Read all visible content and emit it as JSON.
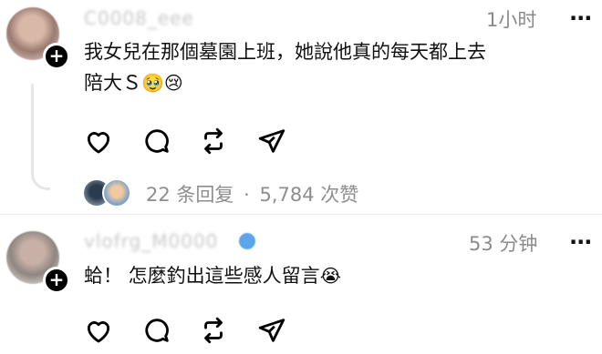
{
  "comments": [
    {
      "username": "C0008_eee",
      "time": "1小时",
      "text_line1": "我女兒在那個墓園上班，她說他真的每天都上去",
      "text_line2": "陪大Ｓ",
      "emoji": "🥹😢",
      "replies_count": "22 条回复",
      "separator": "·",
      "likes": "5,784 次赞"
    },
    {
      "username": "vlofrg_M0000",
      "time": "53 分钟",
      "text_line1": "蛤！ 怎麼釣出這些感人留言",
      "emoji": "😭"
    }
  ],
  "more_icon": "···",
  "plus_icon": "+",
  "colors": {
    "accent": "#000000",
    "muted": "#8e8e8e",
    "thread": "#e6e6e6",
    "verified": "#5aa6e8"
  }
}
